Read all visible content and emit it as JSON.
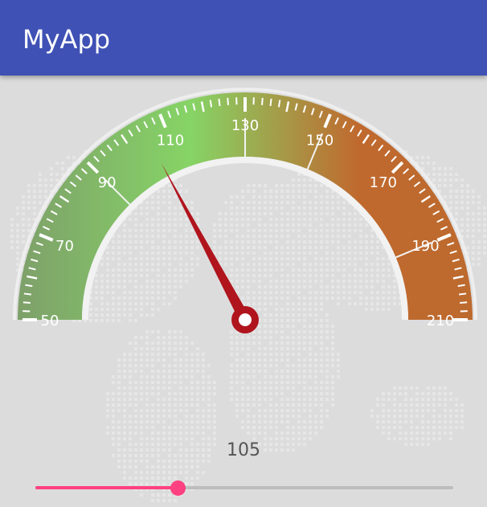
{
  "app_bar": {
    "title": "MyApp",
    "color": "#3f51b5"
  },
  "gauge": {
    "min": 50,
    "max": 210,
    "major_labels": [
      "50",
      "70",
      "90",
      "110",
      "130",
      "150",
      "170",
      "190",
      "210"
    ],
    "value": 105,
    "needle_color": "#b0141d",
    "gradient_colors": [
      "#7ea06a",
      "#86d466",
      "#c0692e"
    ]
  },
  "value_display": "105",
  "slider": {
    "value_fraction": 0.34,
    "accent_color": "#ff4081",
    "track_color": "#bdbdbd"
  },
  "background": {
    "decoration": "world-map-dots"
  }
}
